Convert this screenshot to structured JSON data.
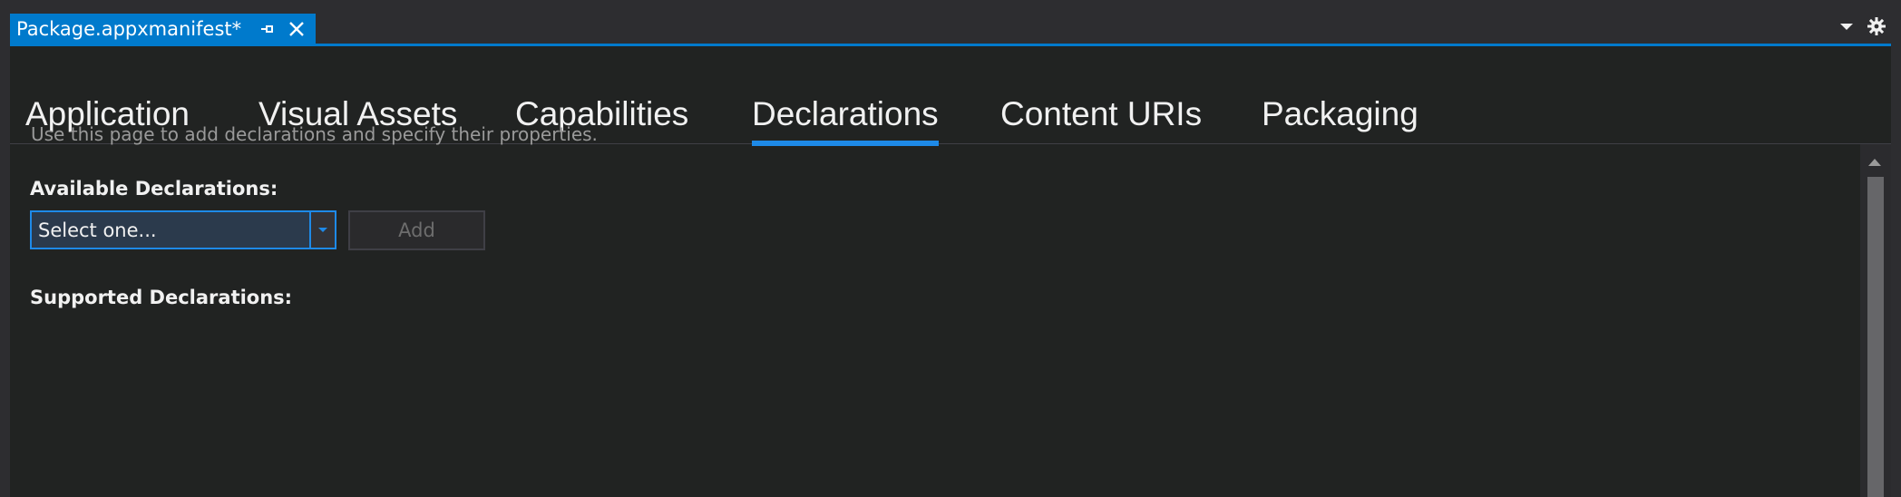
{
  "document_tab": {
    "title": "Package.appxmanifest*",
    "pin_icon": "pin-icon",
    "close_icon": "close-icon"
  },
  "window_controls": {
    "dropdown_icon": "chevron-down-icon",
    "settings_icon": "gear-icon"
  },
  "manifest_tabs": [
    {
      "label": "Application",
      "active": false
    },
    {
      "label": "Visual Assets",
      "active": false
    },
    {
      "label": "Capabilities",
      "active": false
    },
    {
      "label": "Declarations",
      "active": true
    },
    {
      "label": "Content URIs",
      "active": false
    },
    {
      "label": "Packaging",
      "active": false
    }
  ],
  "declarations_page": {
    "intro": "Use this page to add declarations and specify their properties.",
    "available_label": "Available Declarations:",
    "select_value": "Select one...",
    "add_label": "Add",
    "supported_label": "Supported Declarations:"
  },
  "colors": {
    "accent": "#007acc",
    "active_tab_underline": "#1e8ae8",
    "editor_background": "#212322"
  }
}
